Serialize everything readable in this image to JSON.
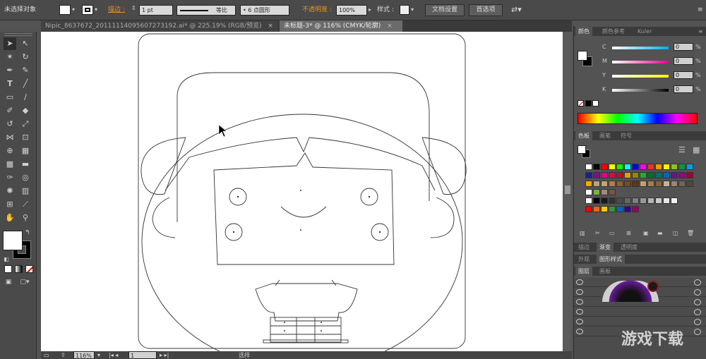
{
  "control_bar": {
    "selection_status": "未选择对象",
    "stroke_label": "描边 :",
    "stroke_weight": "1 pt",
    "stroke_style": "等比",
    "brush_label": "6 点圆形",
    "opacity_label": "不透明度 :",
    "opacity_value": "100%",
    "style_label": "样式 :",
    "doc_settings_button": "文档设置",
    "preferences_button": "首选项",
    "accent_color": "#e8921c"
  },
  "doc_tabs": [
    {
      "label": "Nipic_8637672_20111114095607273192.ai* @ 225.19% (RGB/预览)",
      "close": "×"
    },
    {
      "label": "未标题-3* @ 116% (CMYK/轮廓)",
      "close": "×"
    }
  ],
  "status_bar": {
    "zoom": "116%",
    "artboard": "1",
    "tool_name": "选择"
  },
  "panels": {
    "color": {
      "tabs": [
        "颜色",
        "颜色参考",
        "Kuler"
      ],
      "channels": [
        {
          "label": "C",
          "value": "0",
          "unit": "%"
        },
        {
          "label": "M",
          "value": "0",
          "unit": "%"
        },
        {
          "label": "Y",
          "value": "0",
          "unit": "%"
        },
        {
          "label": "K",
          "value": "0",
          "unit": "%"
        }
      ]
    },
    "swatches": {
      "tabs": [
        "色板",
        "画笔",
        "符号"
      ]
    },
    "gradient": {
      "tabs": [
        "描边",
        "渐变",
        "透明度"
      ]
    },
    "appearance": {
      "tabs": [
        "外观",
        "图形样式"
      ]
    },
    "layers": {
      "tabs": [
        "图层",
        "画板"
      ]
    }
  },
  "watermark": "游戏下载"
}
